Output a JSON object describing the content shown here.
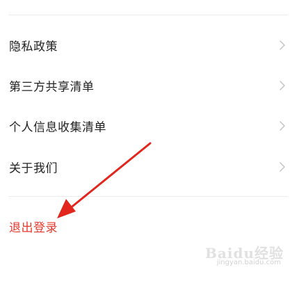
{
  "menu": {
    "items": [
      {
        "label": "隐私政策",
        "icon": "chevron-right-icon"
      },
      {
        "label": "第三方共享清单",
        "icon": "chevron-right-icon"
      },
      {
        "label": "个人信息收集清单",
        "icon": "chevron-right-icon"
      },
      {
        "label": "关于我们",
        "icon": "chevron-right-icon"
      }
    ]
  },
  "logout": {
    "label": "退出登录",
    "color": "#e8392e"
  },
  "annotation": {
    "arrow_color": "#e3261d"
  },
  "watermark": {
    "brand": "Baidu经验",
    "site": "jingyan.baidu.com"
  },
  "colors": {
    "text": "#222222",
    "divider": "#ececec",
    "chevron": "#c4c4c4"
  }
}
